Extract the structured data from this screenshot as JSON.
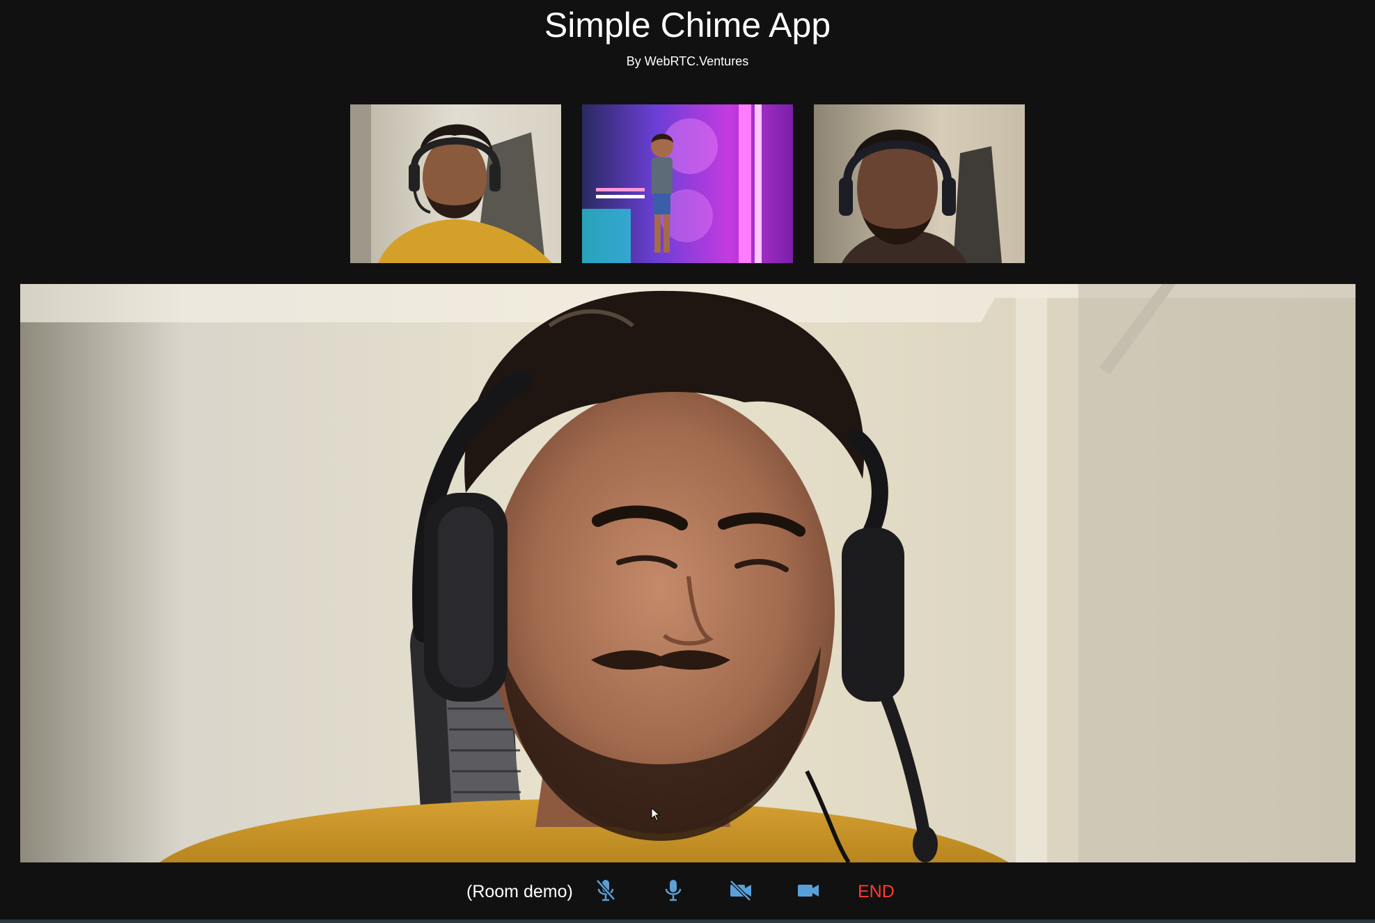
{
  "header": {
    "title": "Simple Chime App",
    "subtitle": "By WebRTC.Ventures"
  },
  "thumbnails": [
    {
      "name": "participant-1-video"
    },
    {
      "name": "participant-2-video"
    },
    {
      "name": "participant-3-video"
    }
  ],
  "controls": {
    "room_label": "(Room demo)",
    "mute_icon": "mic-off-icon",
    "unmute_icon": "mic-icon",
    "camera_off_icon": "video-off-icon",
    "camera_on_icon": "video-icon",
    "end_label": "END"
  },
  "colors": {
    "background": "#111111",
    "end": "#ff3b30",
    "icon": "#5aa0d8"
  }
}
